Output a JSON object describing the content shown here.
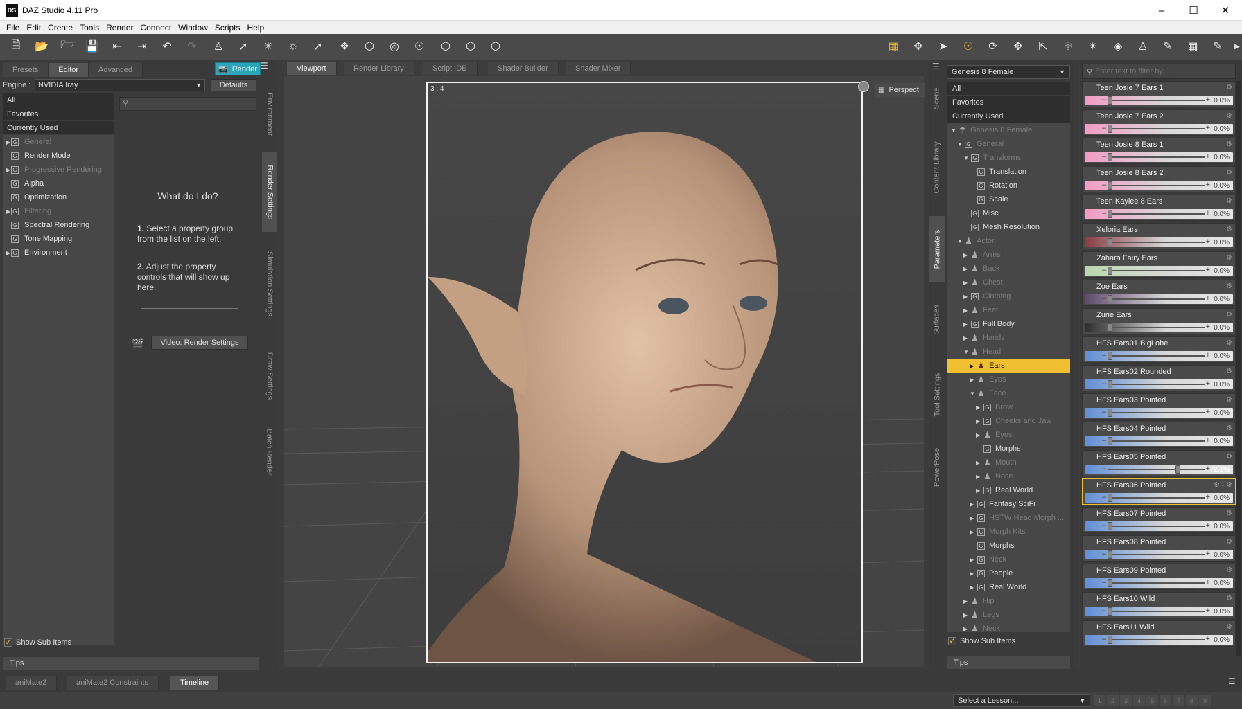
{
  "app": {
    "title": "DAZ Studio 4.11 Pro",
    "logo": "DS"
  },
  "menu": [
    "File",
    "Edit",
    "Create",
    "Tools",
    "Render",
    "Connect",
    "Window",
    "Scripts",
    "Help"
  ],
  "left": {
    "tabs": [
      "Presets",
      "Editor",
      "Advanced"
    ],
    "render_label": "Render",
    "engine_label": "Engine :",
    "engine_value": "NVIDIA Iray",
    "defaults_label": "Defaults",
    "groups": [
      {
        "label": "All",
        "kind": "top"
      },
      {
        "label": "Favorites",
        "kind": "top"
      },
      {
        "label": "Currently Used",
        "kind": "top"
      },
      {
        "label": "General",
        "kind": "dim",
        "arrow": true
      },
      {
        "label": "Render Mode"
      },
      {
        "label": "Progressive Rendering",
        "kind": "dim",
        "arrow": true
      },
      {
        "label": "Alpha"
      },
      {
        "label": "Optimization"
      },
      {
        "label": "Filtering",
        "kind": "dim",
        "arrow": true
      },
      {
        "label": "Spectral Rendering"
      },
      {
        "label": "Tone Mapping"
      },
      {
        "label": "Environment",
        "arrow": true
      }
    ],
    "help_title": "What do I do?",
    "step1_num": "1.",
    "step1": "Select a property group from the list on the left.",
    "step2_num": "2.",
    "step2": "Adjust the property controls that will show up here.",
    "video_button": "Video: Render Settings",
    "show_sub_items": "Show Sub Items",
    "tips": "Tips",
    "side_tabs": [
      "Environment",
      "Render Settings",
      "Simulation Settings",
      "Draw Settings",
      "Batch Render"
    ]
  },
  "viewport": {
    "tabs": [
      "Viewport",
      "Render Library",
      "Script IDE",
      "Shader Builder",
      "Shader Mixer"
    ],
    "aspect": "3 : 4",
    "camera": "Perspect"
  },
  "scene_tabs": [
    "Scene",
    "Content Library",
    "Parameters",
    "Surfaces",
    "Tool Settings",
    "PowerPose"
  ],
  "params": {
    "figure": "Genesis 8 Female",
    "filter_placeholder": "Enter text to filter by...",
    "tree": [
      {
        "label": "All",
        "indent": 0,
        "kind": "top"
      },
      {
        "label": "Favorites",
        "indent": 0,
        "kind": "top"
      },
      {
        "label": "Currently Used",
        "indent": 0,
        "kind": "top"
      },
      {
        "label": "Genesis 8 Female",
        "indent": 0,
        "icon": "figure",
        "arrow": "down",
        "dim": true
      },
      {
        "label": "General",
        "indent": 1,
        "icon": "G",
        "arrow": "down",
        "dim": true
      },
      {
        "label": "Transforms",
        "indent": 2,
        "icon": "G",
        "arrow": "down",
        "dim": true
      },
      {
        "label": "Translation",
        "indent": 3,
        "icon": "G"
      },
      {
        "label": "Rotation",
        "indent": 3,
        "icon": "G"
      },
      {
        "label": "Scale",
        "indent": 3,
        "icon": "G"
      },
      {
        "label": "Misc",
        "indent": 2,
        "icon": "G"
      },
      {
        "label": "Mesh Resolution",
        "indent": 2,
        "icon": "G"
      },
      {
        "label": "Actor",
        "indent": 1,
        "icon": "person",
        "arrow": "down",
        "dim": true
      },
      {
        "label": "Arms",
        "indent": 2,
        "icon": "person",
        "arrow": "right",
        "dim": true
      },
      {
        "label": "Back",
        "indent": 2,
        "icon": "person",
        "arrow": "right",
        "dim": true
      },
      {
        "label": "Chest",
        "indent": 2,
        "icon": "person",
        "arrow": "right",
        "dim": true
      },
      {
        "label": "Clothing",
        "indent": 2,
        "icon": "G",
        "arrow": "right",
        "dim": true
      },
      {
        "label": "Feet",
        "indent": 2,
        "icon": "person",
        "arrow": "right",
        "dim": true
      },
      {
        "label": "Full Body",
        "indent": 2,
        "icon": "G",
        "arrow": "right"
      },
      {
        "label": "Hands",
        "indent": 2,
        "icon": "person",
        "arrow": "right",
        "dim": true
      },
      {
        "label": "Head",
        "indent": 2,
        "icon": "person",
        "arrow": "down",
        "dim": true
      },
      {
        "label": "Ears",
        "indent": 3,
        "icon": "person",
        "arrow": "right",
        "selected": true
      },
      {
        "label": "Eyes",
        "indent": 3,
        "icon": "person",
        "arrow": "right",
        "dim": true
      },
      {
        "label": "Face",
        "indent": 3,
        "icon": "person",
        "arrow": "down",
        "dim": true
      },
      {
        "label": "Brow",
        "indent": 4,
        "icon": "G",
        "arrow": "right",
        "dim": true
      },
      {
        "label": "Cheeks and Jaw",
        "indent": 4,
        "icon": "G",
        "arrow": "right",
        "dim": true
      },
      {
        "label": "Eyes",
        "indent": 4,
        "icon": "person",
        "arrow": "right",
        "dim": true
      },
      {
        "label": "Morphs",
        "indent": 4,
        "icon": "G"
      },
      {
        "label": "Mouth",
        "indent": 4,
        "icon": "person",
        "arrow": "right",
        "dim": true
      },
      {
        "label": "Nose",
        "indent": 4,
        "icon": "person",
        "arrow": "right",
        "dim": true
      },
      {
        "label": "Real World",
        "indent": 4,
        "icon": "G",
        "arrow": "right"
      },
      {
        "label": "Fantasy SciFi",
        "indent": 3,
        "icon": "G",
        "arrow": "right"
      },
      {
        "label": "HSTW Head Morph ...",
        "indent": 3,
        "icon": "G",
        "arrow": "right",
        "dim": true
      },
      {
        "label": "Morph Kits",
        "indent": 3,
        "icon": "G",
        "arrow": "right",
        "dim": true
      },
      {
        "label": "Morphs",
        "indent": 3,
        "icon": "G"
      },
      {
        "label": "Neck",
        "indent": 3,
        "icon": "G",
        "arrow": "right",
        "dim": true
      },
      {
        "label": "People",
        "indent": 3,
        "icon": "G",
        "arrow": "right"
      },
      {
        "label": "Real World",
        "indent": 3,
        "icon": "G",
        "arrow": "right"
      },
      {
        "label": "Hip",
        "indent": 2,
        "icon": "person",
        "arrow": "right",
        "dim": true
      },
      {
        "label": "Legs",
        "indent": 2,
        "icon": "person",
        "arrow": "right",
        "dim": true
      },
      {
        "label": "Neck",
        "indent": 2,
        "icon": "person",
        "arrow": "right",
        "dim": true
      }
    ],
    "show_sub_items": "Show Sub Items",
    "tips": "Tips",
    "sliders": [
      {
        "label": "Teen Josie 7 Ears 1",
        "value": "0.0%",
        "color": "#f29bc3"
      },
      {
        "label": "Teen Josie 7 Ears 2",
        "value": "0.0%",
        "color": "#f29bc3"
      },
      {
        "label": "Teen Josie 8 Ears 1",
        "value": "0.0%",
        "color": "#f29bc3"
      },
      {
        "label": "Teen Josie 8 Ears 2",
        "value": "0.0%",
        "color": "#f29bc3"
      },
      {
        "label": "Teen Kaylee 8 Ears",
        "value": "0.0%",
        "color": "#f29bc3"
      },
      {
        "label": "Xeloria Ears",
        "value": "0.0%",
        "color": "#8a3b44"
      },
      {
        "label": "Zahara Fairy Ears",
        "value": "0.0%",
        "color": "#b8d8ad"
      },
      {
        "label": "Zoe Ears",
        "value": "0.0%",
        "color": "#5e4a6e"
      },
      {
        "label": "Zurie Ears",
        "value": "0.0%",
        "color": "#2c2c2c"
      },
      {
        "label": "HFS Ears01 BigLobe",
        "value": "0.0%",
        "color": "#5f8ed6"
      },
      {
        "label": "HFS Ears02 Rounded",
        "value": "0.0%",
        "color": "#5f8ed6"
      },
      {
        "label": "HFS Ears03 Pointed",
        "value": "0.0%",
        "color": "#5f8ed6"
      },
      {
        "label": "HFS Ears04 Pointed",
        "value": "0.0%",
        "color": "#5f8ed6"
      },
      {
        "label": "HFS Ears05 Pointed",
        "value": "72.1%",
        "color": "#5f8ed6",
        "level": 0.721
      },
      {
        "label": "HFS Ears06 Pointed",
        "value": "0.0%",
        "color": "#5f8ed6",
        "highlight": true
      },
      {
        "label": "HFS Ears07 Pointed",
        "value": "0.0%",
        "color": "#5f8ed6"
      },
      {
        "label": "HFS Ears08 Pointed",
        "value": "0.0%",
        "color": "#5f8ed6"
      },
      {
        "label": "HFS Ears09 Pointed",
        "value": "0.0%",
        "color": "#5f8ed6"
      },
      {
        "label": "HFS Ears10 Wild",
        "value": "0.0%",
        "color": "#5f8ed6"
      },
      {
        "label": "HFS Ears11 Wild",
        "value": "0.0%",
        "color": "#5f8ed6"
      }
    ]
  },
  "bottom": {
    "tabs": [
      "aniMate2",
      "aniMate2 Constraints",
      "Timeline"
    ],
    "lesson": "Select a Lesson...",
    "lesson_pages": [
      "1",
      "2",
      "3",
      "4",
      "5",
      "6",
      "7",
      "8",
      "9"
    ]
  },
  "colors": {
    "accent": "#f0c030",
    "render_button": "#2aa6b8"
  }
}
